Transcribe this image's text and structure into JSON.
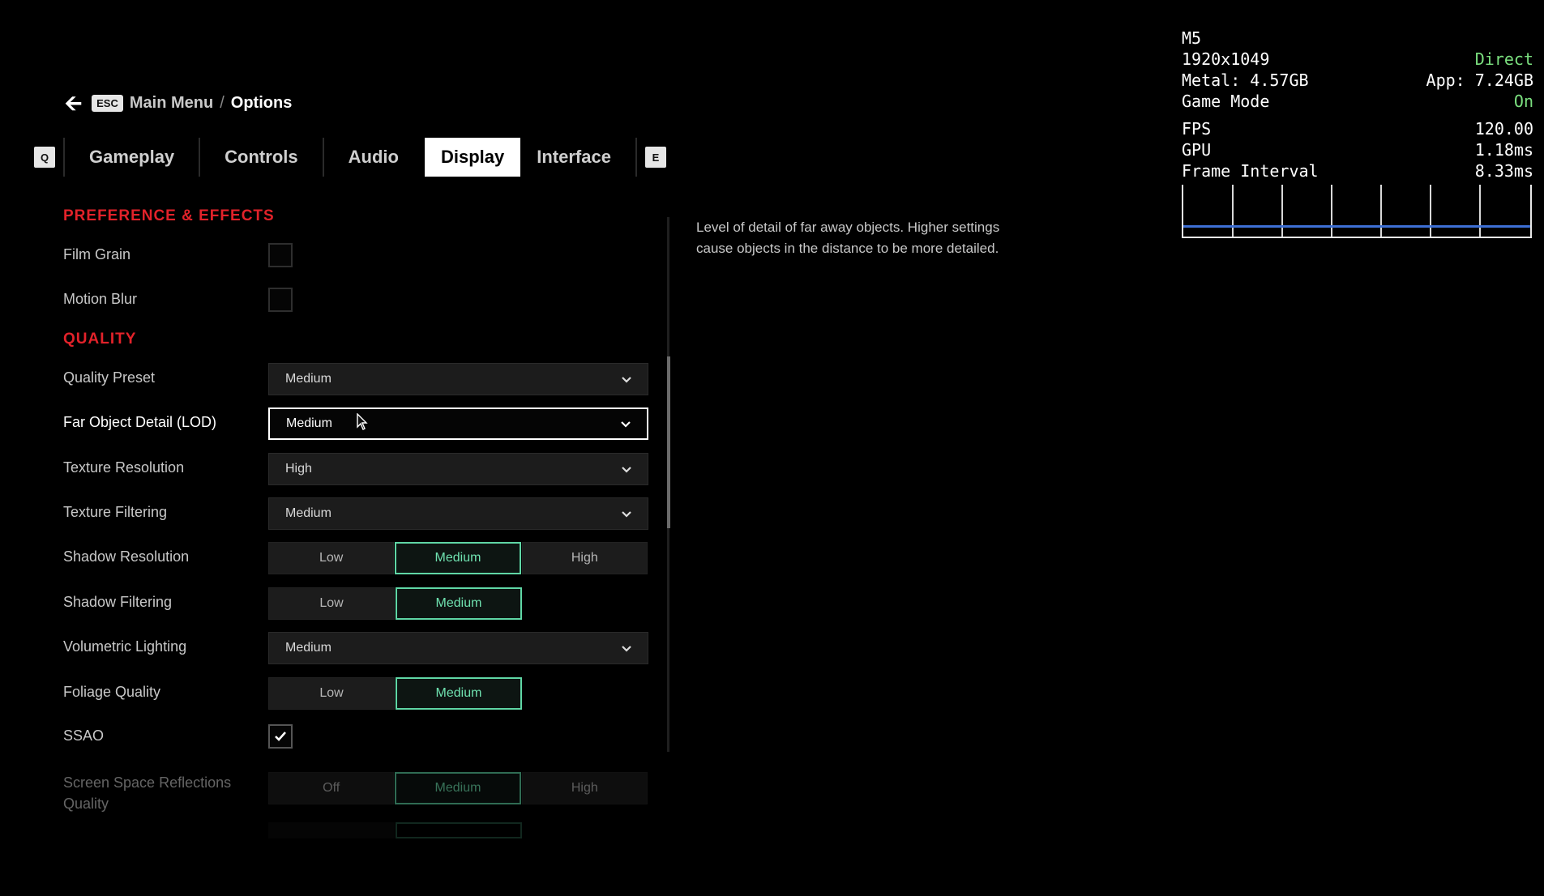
{
  "breadcrumb": {
    "key": "ESC",
    "parent": "Main Menu",
    "separator": "/",
    "current": "Options"
  },
  "tabs": {
    "left_key": "Q",
    "right_key": "E",
    "items": [
      {
        "label": "Gameplay",
        "active": false
      },
      {
        "label": "Controls",
        "active": false
      },
      {
        "label": "Audio",
        "active": false
      },
      {
        "label": "Display",
        "active": true
      },
      {
        "label": "Interface",
        "active": false
      }
    ]
  },
  "sections": {
    "preference": "PREFERENCE & EFFECTS",
    "quality": "QUALITY"
  },
  "settings": {
    "film_grain": {
      "label": "Film Grain",
      "checked": false
    },
    "motion_blur": {
      "label": "Motion Blur",
      "checked": false
    },
    "quality_preset": {
      "label": "Quality Preset",
      "value": "Medium"
    },
    "far_object_detail": {
      "label": "Far Object Detail (LOD)",
      "value": "Medium"
    },
    "texture_resolution": {
      "label": "Texture Resolution",
      "value": "High"
    },
    "texture_filtering": {
      "label": "Texture Filtering",
      "value": "Medium"
    },
    "shadow_resolution": {
      "label": "Shadow Resolution",
      "options": [
        "Low",
        "Medium",
        "High"
      ],
      "selected": "Medium"
    },
    "shadow_filtering": {
      "label": "Shadow Filtering",
      "options": [
        "Low",
        "Medium"
      ],
      "selected": "Medium"
    },
    "volumetric_lighting": {
      "label": "Volumetric Lighting",
      "value": "Medium"
    },
    "foliage_quality": {
      "label": "Foliage Quality",
      "options": [
        "Low",
        "Medium"
      ],
      "selected": "Medium"
    },
    "ssao": {
      "label": "SSAO",
      "checked": true
    },
    "ssr_quality": {
      "label_line1": "Screen Space Reflections",
      "label_line2": "Quality",
      "options": [
        "Off",
        "Medium",
        "High"
      ],
      "selected": "Medium"
    }
  },
  "description": "Level of detail of far away objects. Higher settings cause objects in the distance to be more detailed.",
  "perf": {
    "device": "M5",
    "resolution": "1920x1049",
    "mode": "Direct",
    "metal": "Metal: 4.57GB",
    "app": "App: 7.24GB",
    "game_mode_label": "Game Mode",
    "game_mode_value": "On",
    "fps_label": "FPS",
    "fps_value": "120.00",
    "gpu_label": "GPU",
    "gpu_value": "1.18ms",
    "frame_interval_label": "Frame Interval",
    "frame_interval_value": "8.33ms"
  },
  "colors": {
    "accent_red": "#e2222a",
    "selected_green": "#5fd6a5",
    "perf_green": "#7be07f",
    "graph_blue": "#3d6fd4"
  },
  "icons": [
    "back-arrow-icon",
    "chevron-down-icon",
    "checkmark-icon",
    "mouse-cursor-icon"
  ]
}
